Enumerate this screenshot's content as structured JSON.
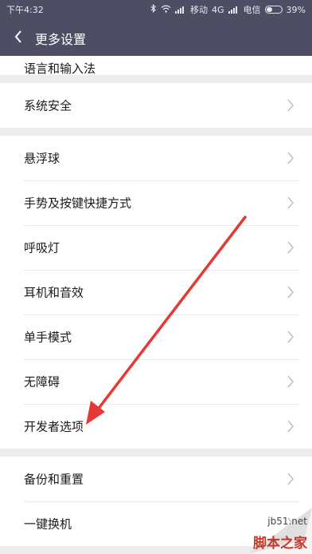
{
  "status_bar": {
    "time": "下午4:32",
    "carrier1": "移动",
    "network1": "4G",
    "carrier2": "电信",
    "battery": "39%",
    "icons": [
      "bluetooth-icon",
      "wifi-icon",
      "signal-icon",
      "battery-icon"
    ]
  },
  "header": {
    "title": "更多设置",
    "back_icon": "chevron-left-icon"
  },
  "settings": {
    "partial_item": "语言和输入法",
    "group1": [
      {
        "label": "系统安全"
      }
    ],
    "group2": [
      {
        "label": "悬浮球"
      },
      {
        "label": "手势及按键快捷方式"
      },
      {
        "label": "呼吸灯"
      },
      {
        "label": "耳机和音效"
      },
      {
        "label": "单手模式"
      },
      {
        "label": "无障碍"
      },
      {
        "label": "开发者选项"
      }
    ],
    "group3": [
      {
        "label": "备份和重置"
      },
      {
        "label": "一键换机"
      }
    ]
  },
  "annotation": {
    "arrow_color": "#e53935"
  },
  "watermark": {
    "url": "jb51.net",
    "brand": "脚本之家"
  },
  "colors": {
    "header_bg": "#4d4e63",
    "page_bg": "#ececec",
    "row_bg": "#ffffff"
  }
}
